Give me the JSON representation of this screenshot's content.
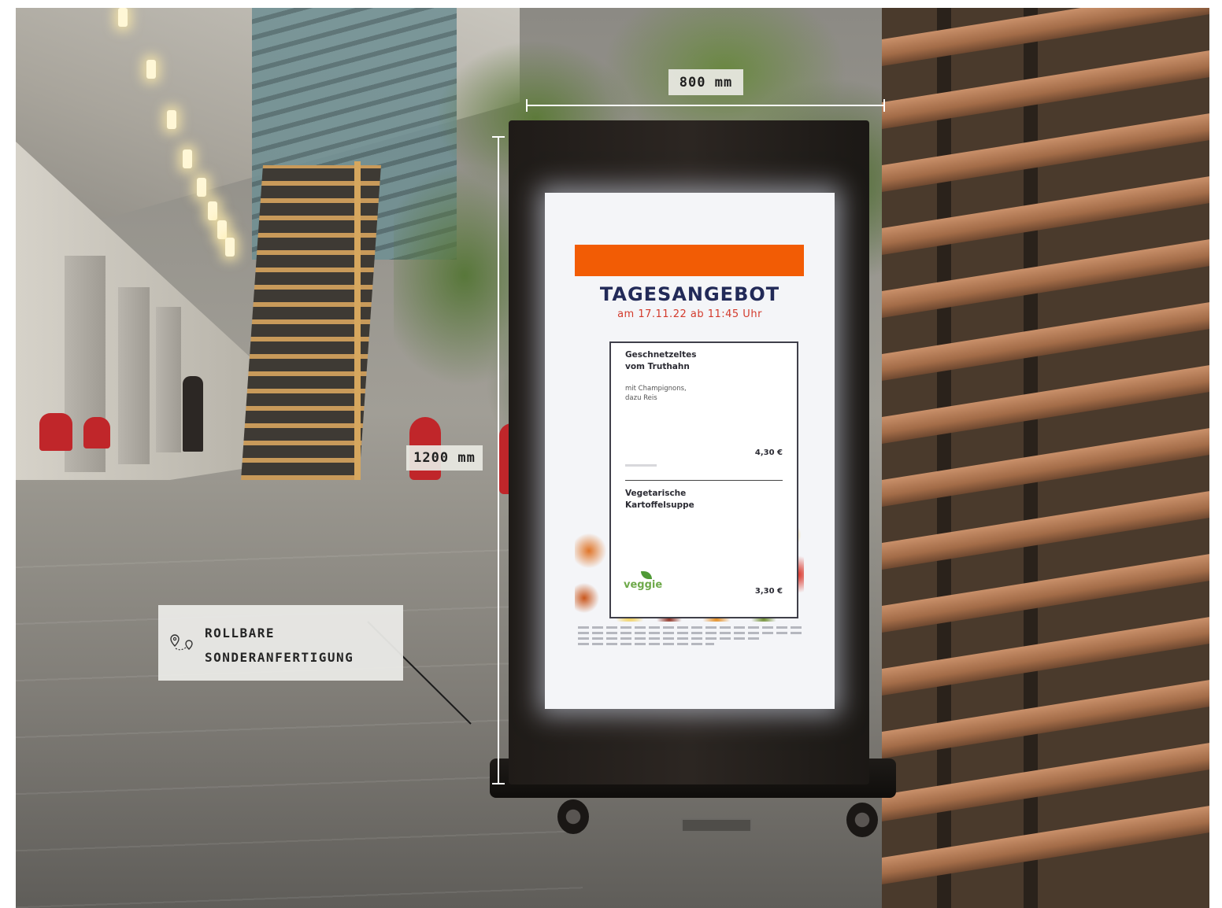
{
  "dimensions": {
    "width_label": "800 mm",
    "height_label": "1200 mm"
  },
  "callout": {
    "line1": "ROLLBARE",
    "line2": "SONDERANFERTIGUNG",
    "icon": "route-pin-icon"
  },
  "screen": {
    "title": "TAGESANGEBOT",
    "subtitle": "am 17.11.22 ab 11:45 Uhr",
    "accent_color": "#f25c05",
    "title_color": "#222a58",
    "dishes": [
      {
        "name_line1": "Geschnetzeltes",
        "name_line2": "vom Truthahn",
        "desc_line1": "mit Champignons,",
        "desc_line2": "dazu Reis",
        "price": "4,30 €"
      },
      {
        "name_line1": "Vegetarische",
        "name_line2": "Kartoffelsuppe",
        "price": "3,30 €",
        "badge": "veggie"
      }
    ]
  }
}
